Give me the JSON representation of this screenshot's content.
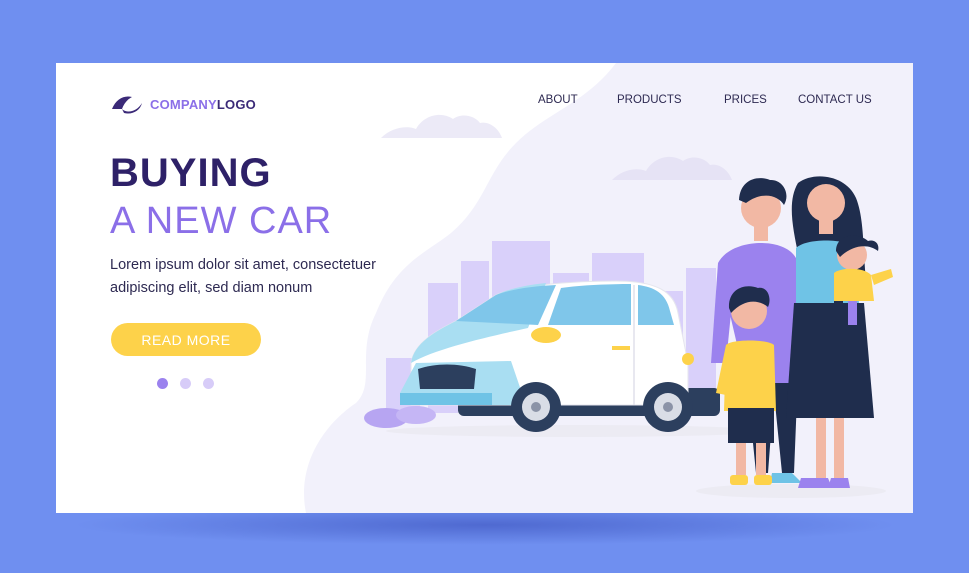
{
  "logo": {
    "part1": "COMPANY",
    "part2": "LOGO",
    "icon": "swoosh-logo-mark"
  },
  "nav": {
    "items": [
      {
        "label": "ABOUT"
      },
      {
        "label": "PRODUCTS"
      },
      {
        "label": "PRICES"
      },
      {
        "label": "CONTACT US"
      }
    ]
  },
  "hero": {
    "title_line1": "BUYING",
    "title_line2": "A NEW CAR",
    "body": "Lorem ipsum dolor sit amet, consectetuer adipiscing elit, sed diam nonum",
    "cta": "READ MORE"
  },
  "carousel": {
    "count": 3,
    "active_index": 1
  },
  "colors": {
    "background": "#6f8ff0",
    "primary_dark": "#2e2168",
    "accent_purple": "#8b6fe8",
    "cta_yellow": "#fdd24a",
    "car_blue": "#9ed8f0"
  }
}
